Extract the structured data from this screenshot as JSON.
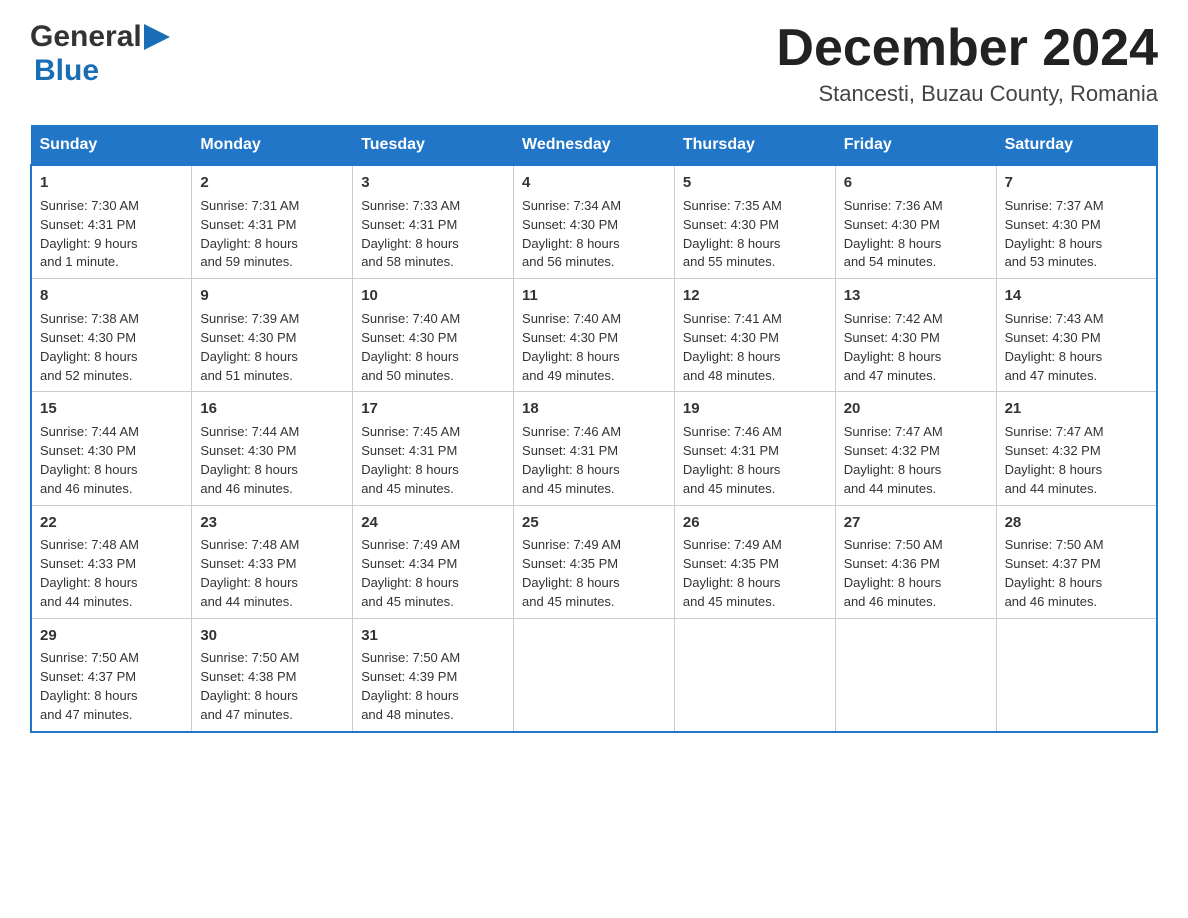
{
  "header": {
    "logo_general": "General",
    "logo_blue": "Blue",
    "month_title": "December 2024",
    "location": "Stancesti, Buzau County, Romania"
  },
  "days_of_week": [
    "Sunday",
    "Monday",
    "Tuesday",
    "Wednesday",
    "Thursday",
    "Friday",
    "Saturday"
  ],
  "weeks": [
    [
      {
        "day": "1",
        "sunrise": "Sunrise: 7:30 AM",
        "sunset": "Sunset: 4:31 PM",
        "daylight": "Daylight: 9 hours",
        "daylight2": "and 1 minute."
      },
      {
        "day": "2",
        "sunrise": "Sunrise: 7:31 AM",
        "sunset": "Sunset: 4:31 PM",
        "daylight": "Daylight: 8 hours",
        "daylight2": "and 59 minutes."
      },
      {
        "day": "3",
        "sunrise": "Sunrise: 7:33 AM",
        "sunset": "Sunset: 4:31 PM",
        "daylight": "Daylight: 8 hours",
        "daylight2": "and 58 minutes."
      },
      {
        "day": "4",
        "sunrise": "Sunrise: 7:34 AM",
        "sunset": "Sunset: 4:30 PM",
        "daylight": "Daylight: 8 hours",
        "daylight2": "and 56 minutes."
      },
      {
        "day": "5",
        "sunrise": "Sunrise: 7:35 AM",
        "sunset": "Sunset: 4:30 PM",
        "daylight": "Daylight: 8 hours",
        "daylight2": "and 55 minutes."
      },
      {
        "day": "6",
        "sunrise": "Sunrise: 7:36 AM",
        "sunset": "Sunset: 4:30 PM",
        "daylight": "Daylight: 8 hours",
        "daylight2": "and 54 minutes."
      },
      {
        "day": "7",
        "sunrise": "Sunrise: 7:37 AM",
        "sunset": "Sunset: 4:30 PM",
        "daylight": "Daylight: 8 hours",
        "daylight2": "and 53 minutes."
      }
    ],
    [
      {
        "day": "8",
        "sunrise": "Sunrise: 7:38 AM",
        "sunset": "Sunset: 4:30 PM",
        "daylight": "Daylight: 8 hours",
        "daylight2": "and 52 minutes."
      },
      {
        "day": "9",
        "sunrise": "Sunrise: 7:39 AM",
        "sunset": "Sunset: 4:30 PM",
        "daylight": "Daylight: 8 hours",
        "daylight2": "and 51 minutes."
      },
      {
        "day": "10",
        "sunrise": "Sunrise: 7:40 AM",
        "sunset": "Sunset: 4:30 PM",
        "daylight": "Daylight: 8 hours",
        "daylight2": "and 50 minutes."
      },
      {
        "day": "11",
        "sunrise": "Sunrise: 7:40 AM",
        "sunset": "Sunset: 4:30 PM",
        "daylight": "Daylight: 8 hours",
        "daylight2": "and 49 minutes."
      },
      {
        "day": "12",
        "sunrise": "Sunrise: 7:41 AM",
        "sunset": "Sunset: 4:30 PM",
        "daylight": "Daylight: 8 hours",
        "daylight2": "and 48 minutes."
      },
      {
        "day": "13",
        "sunrise": "Sunrise: 7:42 AM",
        "sunset": "Sunset: 4:30 PM",
        "daylight": "Daylight: 8 hours",
        "daylight2": "and 47 minutes."
      },
      {
        "day": "14",
        "sunrise": "Sunrise: 7:43 AM",
        "sunset": "Sunset: 4:30 PM",
        "daylight": "Daylight: 8 hours",
        "daylight2": "and 47 minutes."
      }
    ],
    [
      {
        "day": "15",
        "sunrise": "Sunrise: 7:44 AM",
        "sunset": "Sunset: 4:30 PM",
        "daylight": "Daylight: 8 hours",
        "daylight2": "and 46 minutes."
      },
      {
        "day": "16",
        "sunrise": "Sunrise: 7:44 AM",
        "sunset": "Sunset: 4:30 PM",
        "daylight": "Daylight: 8 hours",
        "daylight2": "and 46 minutes."
      },
      {
        "day": "17",
        "sunrise": "Sunrise: 7:45 AM",
        "sunset": "Sunset: 4:31 PM",
        "daylight": "Daylight: 8 hours",
        "daylight2": "and 45 minutes."
      },
      {
        "day": "18",
        "sunrise": "Sunrise: 7:46 AM",
        "sunset": "Sunset: 4:31 PM",
        "daylight": "Daylight: 8 hours",
        "daylight2": "and 45 minutes."
      },
      {
        "day": "19",
        "sunrise": "Sunrise: 7:46 AM",
        "sunset": "Sunset: 4:31 PM",
        "daylight": "Daylight: 8 hours",
        "daylight2": "and 45 minutes."
      },
      {
        "day": "20",
        "sunrise": "Sunrise: 7:47 AM",
        "sunset": "Sunset: 4:32 PM",
        "daylight": "Daylight: 8 hours",
        "daylight2": "and 44 minutes."
      },
      {
        "day": "21",
        "sunrise": "Sunrise: 7:47 AM",
        "sunset": "Sunset: 4:32 PM",
        "daylight": "Daylight: 8 hours",
        "daylight2": "and 44 minutes."
      }
    ],
    [
      {
        "day": "22",
        "sunrise": "Sunrise: 7:48 AM",
        "sunset": "Sunset: 4:33 PM",
        "daylight": "Daylight: 8 hours",
        "daylight2": "and 44 minutes."
      },
      {
        "day": "23",
        "sunrise": "Sunrise: 7:48 AM",
        "sunset": "Sunset: 4:33 PM",
        "daylight": "Daylight: 8 hours",
        "daylight2": "and 44 minutes."
      },
      {
        "day": "24",
        "sunrise": "Sunrise: 7:49 AM",
        "sunset": "Sunset: 4:34 PM",
        "daylight": "Daylight: 8 hours",
        "daylight2": "and 45 minutes."
      },
      {
        "day": "25",
        "sunrise": "Sunrise: 7:49 AM",
        "sunset": "Sunset: 4:35 PM",
        "daylight": "Daylight: 8 hours",
        "daylight2": "and 45 minutes."
      },
      {
        "day": "26",
        "sunrise": "Sunrise: 7:49 AM",
        "sunset": "Sunset: 4:35 PM",
        "daylight": "Daylight: 8 hours",
        "daylight2": "and 45 minutes."
      },
      {
        "day": "27",
        "sunrise": "Sunrise: 7:50 AM",
        "sunset": "Sunset: 4:36 PM",
        "daylight": "Daylight: 8 hours",
        "daylight2": "and 46 minutes."
      },
      {
        "day": "28",
        "sunrise": "Sunrise: 7:50 AM",
        "sunset": "Sunset: 4:37 PM",
        "daylight": "Daylight: 8 hours",
        "daylight2": "and 46 minutes."
      }
    ],
    [
      {
        "day": "29",
        "sunrise": "Sunrise: 7:50 AM",
        "sunset": "Sunset: 4:37 PM",
        "daylight": "Daylight: 8 hours",
        "daylight2": "and 47 minutes."
      },
      {
        "day": "30",
        "sunrise": "Sunrise: 7:50 AM",
        "sunset": "Sunset: 4:38 PM",
        "daylight": "Daylight: 8 hours",
        "daylight2": "and 47 minutes."
      },
      {
        "day": "31",
        "sunrise": "Sunrise: 7:50 AM",
        "sunset": "Sunset: 4:39 PM",
        "daylight": "Daylight: 8 hours",
        "daylight2": "and 48 minutes."
      },
      null,
      null,
      null,
      null
    ]
  ]
}
